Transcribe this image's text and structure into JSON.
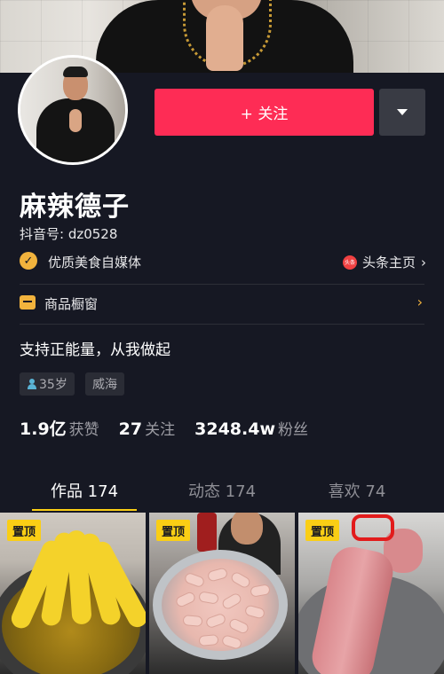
{
  "profile": {
    "name": "麻辣德子",
    "uid_label": "抖音号: dz0528",
    "verification": "优质美食自媒体",
    "toutiao_link": "头条主页",
    "toutiao_icon_text": "头条",
    "shop_window": "商品橱窗",
    "bio": "支持正能量，从我做起",
    "tags": {
      "age": "35岁",
      "city": "威海"
    }
  },
  "actions": {
    "follow_label": "+ 关注",
    "more_icon": "caret-down-icon"
  },
  "stats": [
    {
      "num": "1.9亿",
      "label": "获赞"
    },
    {
      "num": "27",
      "label": "关注"
    },
    {
      "num": "3248.4w",
      "label": "粉丝"
    }
  ],
  "tabs": [
    {
      "label": "作品 174",
      "active": true
    },
    {
      "label": "动态 174",
      "active": false
    },
    {
      "label": "喜欢 74",
      "active": false
    }
  ],
  "videos": [
    {
      "pin": "置顶",
      "subject": "bananas"
    },
    {
      "pin": "置顶",
      "subject": "chicken-wings"
    },
    {
      "pin": "置顶",
      "subject": "pork-loin"
    }
  ],
  "colors": {
    "background": "#161823",
    "follow_button": "#fe2c55",
    "accent_yellow": "#face15",
    "badge_gold": "#f2b33d"
  }
}
